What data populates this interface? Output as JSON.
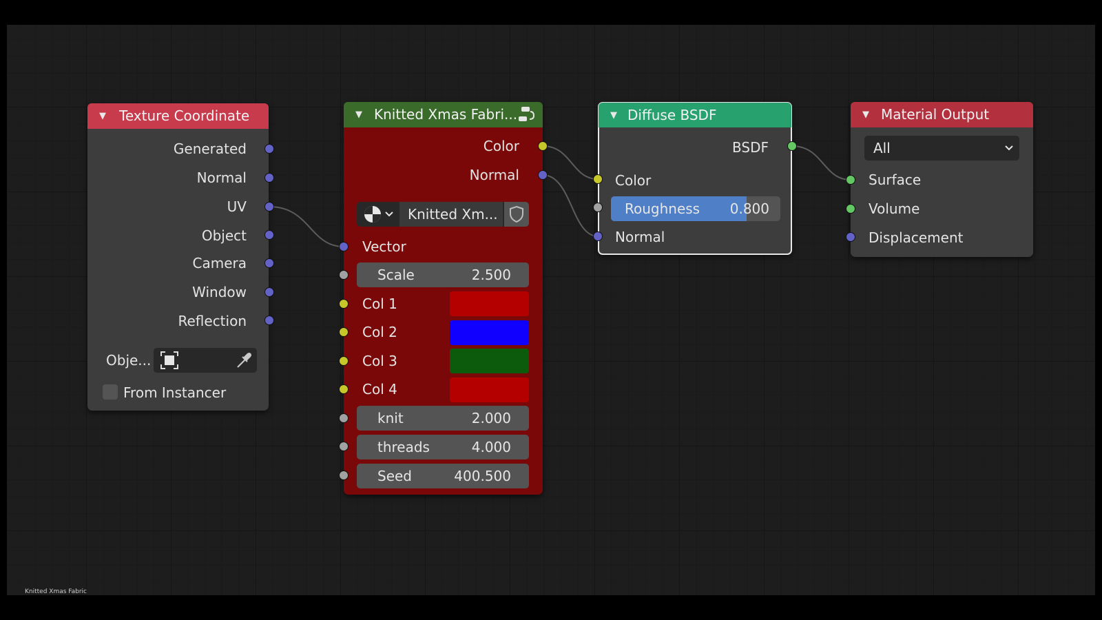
{
  "footer_label": "Knitted Xmas Fabric",
  "colors": {
    "header_texture": "#c83b4c",
    "header_group": "#3a6b2a",
    "header_shader": "#27a26e",
    "header_output": "#b3313f",
    "node_body": "#3d3d3d",
    "group_body": "#7b0808",
    "socket_vector": "#6363c7",
    "socket_color": "#c7c729",
    "socket_float": "#a1a1a1",
    "socket_shader": "#63c763",
    "roughness_fill": "#4f7fc7"
  },
  "nodes": {
    "texture_coordinate": {
      "title": "Texture Coordinate",
      "outputs": [
        "Generated",
        "Normal",
        "UV",
        "Object",
        "Camera",
        "Window",
        "Reflection"
      ],
      "object_label": "Obje...",
      "object_icon": "object-target-icon",
      "picker_icon": "eyedropper-icon",
      "from_instancer_label": "From Instancer",
      "from_instancer_checked": false
    },
    "knitted_group": {
      "title": "Knitted Xmas Fabri...",
      "header_icon": "node-group-icon",
      "outputs": [
        "Color",
        "Normal"
      ],
      "datablock_icon": "node-tree-icon",
      "datablock_name": "Knitted Xm...",
      "fake_user_icon": "shield-icon",
      "vector_label": "Vector",
      "scale": {
        "label": "Scale",
        "value": "2.500"
      },
      "colors": [
        {
          "label": "Col 1",
          "value": "#b50000"
        },
        {
          "label": "Col 2",
          "value": "#0f00ff"
        },
        {
          "label": "Col 3",
          "value": "#0c5a0c"
        },
        {
          "label": "Col 4",
          "value": "#b50000"
        }
      ],
      "knit": {
        "label": "knit",
        "value": "2.000"
      },
      "threads": {
        "label": "threads",
        "value": "4.000"
      },
      "seed": {
        "label": "Seed",
        "value": "400.500"
      }
    },
    "diffuse_bsdf": {
      "title": "Diffuse BSDF",
      "output": "BSDF",
      "color_label": "Color",
      "roughness": {
        "label": "Roughness",
        "value": "0.800",
        "fraction": 0.8
      },
      "normal_label": "Normal"
    },
    "material_output": {
      "title": "Material Output",
      "target": "All",
      "inputs": [
        "Surface",
        "Volume",
        "Displacement"
      ]
    }
  }
}
